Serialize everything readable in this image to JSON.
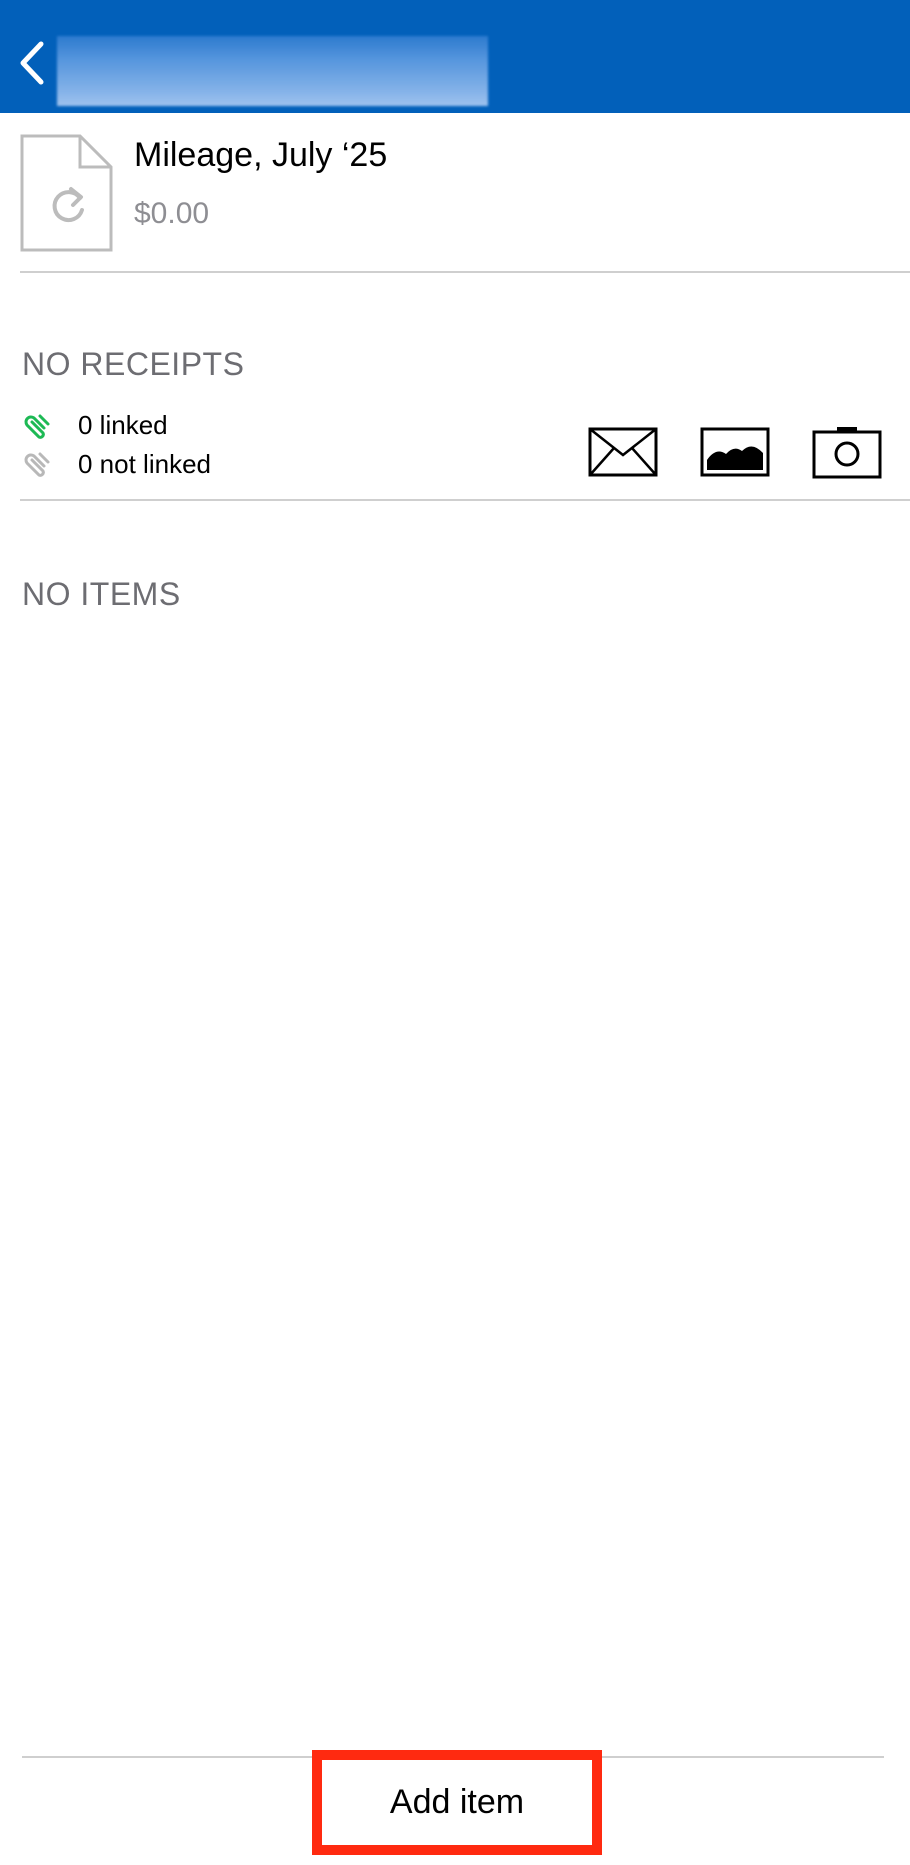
{
  "header": {
    "back_icon": "chevron-left-icon",
    "background_color": "#0260BA"
  },
  "report": {
    "icon": "document-refresh-icon",
    "title": "Mileage, July ‘25",
    "amount": "$0.00"
  },
  "receipts": {
    "section_label": "NO RECEIPTS",
    "linked_label": "0 linked",
    "not_linked_label": "0 not linked",
    "linked_icon_color": "#1DB954",
    "not_linked_icon_color": "#B8B8B8",
    "actions": [
      {
        "name": "email-receipt-button",
        "icon": "envelope-icon"
      },
      {
        "name": "photo-library-button",
        "icon": "image-icon"
      },
      {
        "name": "camera-button",
        "icon": "camera-icon"
      }
    ]
  },
  "items": {
    "section_label": "NO ITEMS"
  },
  "footer": {
    "add_item_label": "Add item",
    "highlight_color": "#FF2A10"
  }
}
